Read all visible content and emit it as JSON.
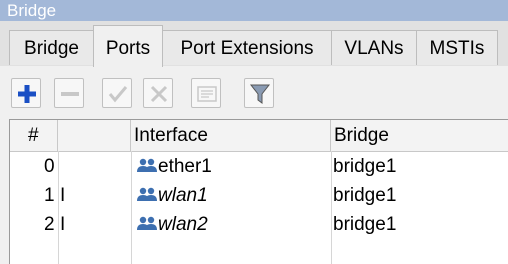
{
  "window": {
    "title": "Bridge"
  },
  "tabs": [
    {
      "label": "Bridge",
      "active": false
    },
    {
      "label": "Ports",
      "active": true
    },
    {
      "label": "Port Extensions",
      "active": false
    },
    {
      "label": "VLANs",
      "active": false
    },
    {
      "label": "MSTIs",
      "active": false
    }
  ],
  "toolbar": {
    "buttons": [
      {
        "icon": "add-icon",
        "enabled": true
      },
      {
        "icon": "remove-icon",
        "enabled": false
      },
      {
        "icon": "enable-icon",
        "enabled": false
      },
      {
        "icon": "disable-icon",
        "enabled": false
      },
      {
        "icon": "comment-icon",
        "enabled": false
      },
      {
        "icon": "filter-icon",
        "enabled": true
      }
    ]
  },
  "table": {
    "columns": [
      "#",
      "",
      "Interface",
      "Bridge"
    ],
    "rows": [
      {
        "index": "0",
        "flag": "",
        "interface": "ether1",
        "italic": false,
        "bridge": "bridge1"
      },
      {
        "index": "1",
        "flag": "I",
        "interface": "wlan1",
        "italic": true,
        "bridge": "bridge1"
      },
      {
        "index": "2",
        "flag": "I",
        "interface": "wlan2",
        "italic": true,
        "bridge": "bridge1"
      }
    ]
  },
  "colors": {
    "titlebar": "#a3b8d8",
    "add_icon": "#1a4fc4",
    "interface_icon": "#3d6fb0"
  }
}
